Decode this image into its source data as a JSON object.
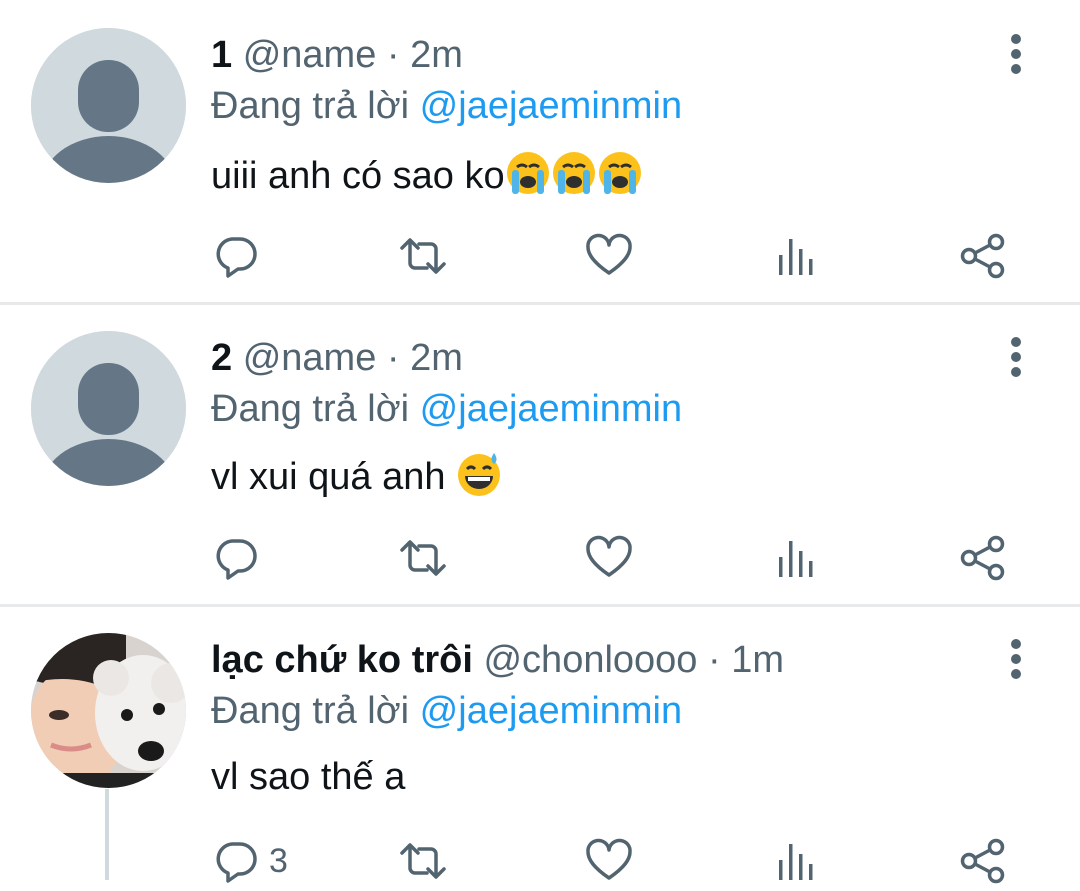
{
  "replying_prefix": "Đang trả lời ",
  "colors": {
    "accent": "#1d9bf0",
    "muted": "#536471",
    "text": "#0f1419",
    "divider": "#e7e9ea"
  },
  "tweets": [
    {
      "display_name": "1",
      "handle_time": " @name · 2m",
      "reply_to": "@jaejaeminmin",
      "text": "uiii anh có sao ko",
      "emojis": [
        "loudly-crying-face",
        "loudly-crying-face",
        "loudly-crying-face"
      ],
      "avatar": "default-profile",
      "reply_count": ""
    },
    {
      "display_name": "2",
      "handle_time": " @name · 2m",
      "reply_to": "@jaejaeminmin",
      "text": "vl xui quá anh ",
      "emojis": [
        "grinning-face-with-sweat"
      ],
      "avatar": "default-profile",
      "reply_count": ""
    },
    {
      "display_name": "lạc chứ ko trôi",
      "handle_time": " @chonloooo · 1m",
      "reply_to": "@jaejaeminmin",
      "text": "vl sao thế a",
      "emojis": [],
      "avatar": "photo-person-with-dog",
      "reply_count": "3"
    }
  ],
  "icons": {
    "reply": "reply-icon",
    "retweet": "retweet-icon",
    "like": "like-icon",
    "views": "views-icon",
    "share": "share-icon",
    "more": "more-icon"
  }
}
